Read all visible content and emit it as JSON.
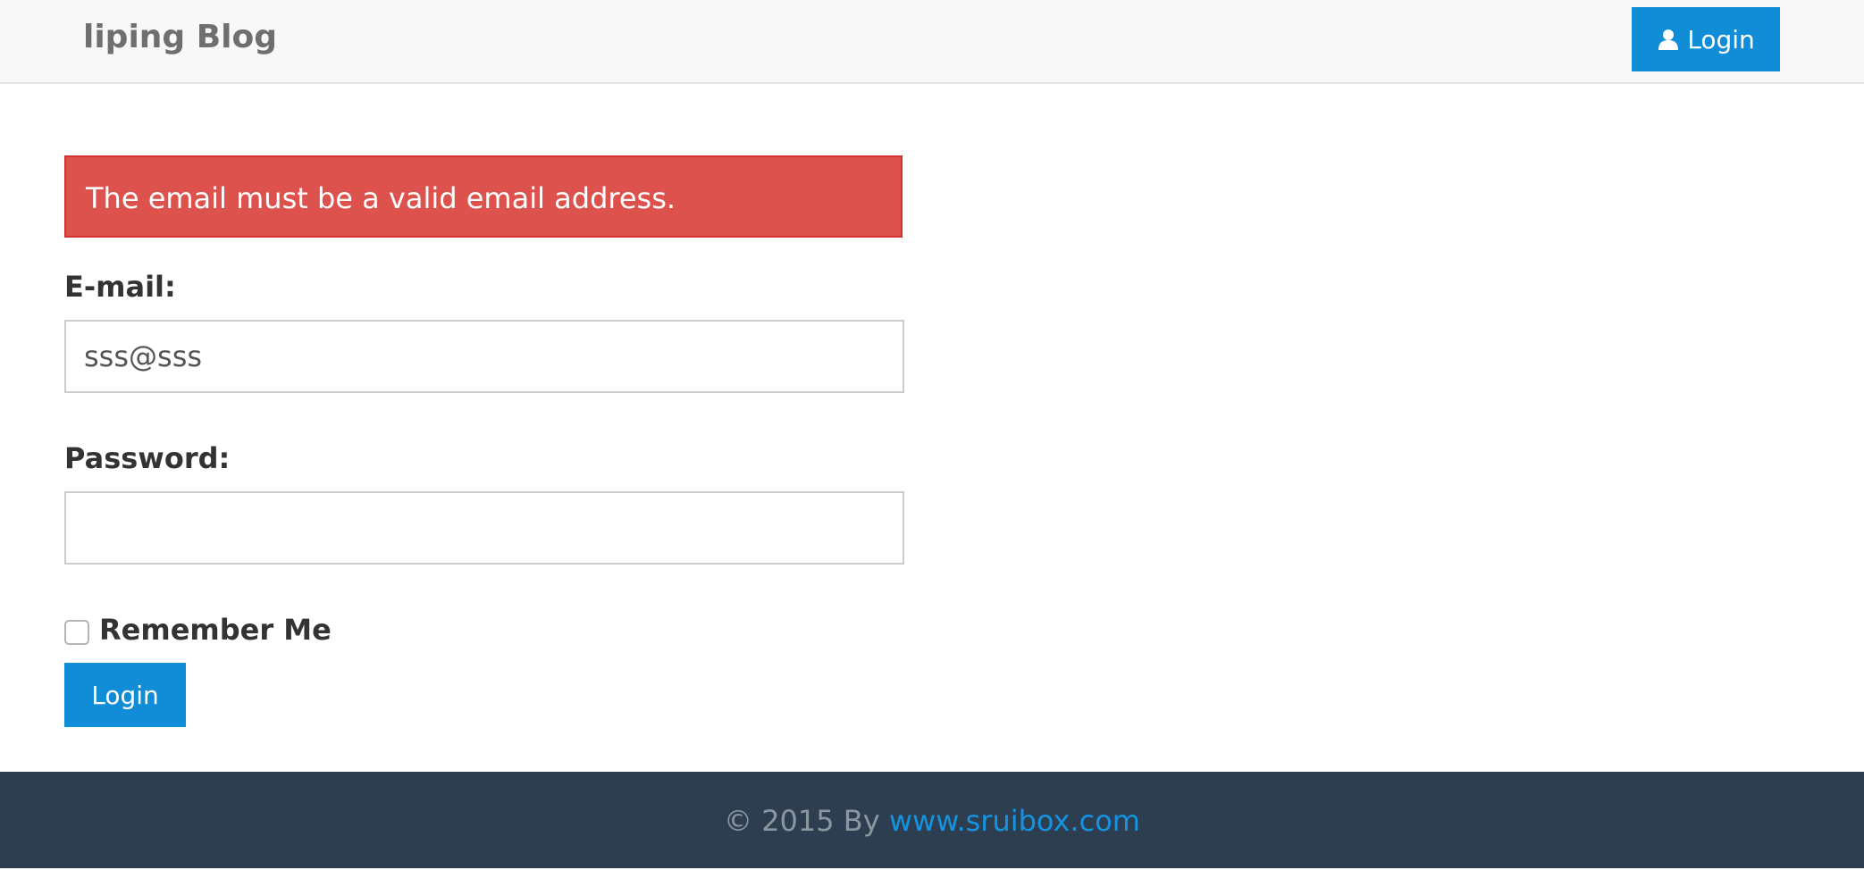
{
  "navbar": {
    "brand": "liping Blog",
    "login_label": "Login",
    "login_icon": "user-icon"
  },
  "alert": {
    "message": "The email must be a valid email address."
  },
  "form": {
    "email_label": "E-mail:",
    "email_value": "sss@sss",
    "password_label": "Password:",
    "password_value": "",
    "remember_label": "Remember Me",
    "remember_checked": false,
    "submit_label": "Login"
  },
  "footer": {
    "copyright": "© 2015 By",
    "link_text": "www.sruibox.com"
  },
  "colors": {
    "primary": "#118dd8",
    "danger": "#dd524d",
    "footer_bg": "#2d3e50"
  }
}
